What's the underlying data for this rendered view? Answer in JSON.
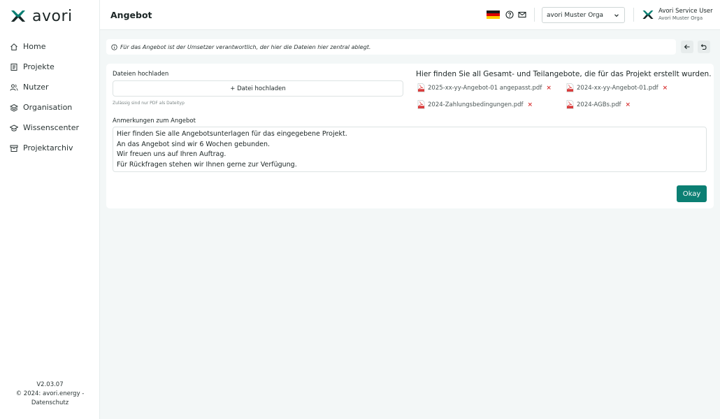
{
  "sidebar": {
    "brand": "avori",
    "items": [
      {
        "label": "Home",
        "icon": "home-icon"
      },
      {
        "label": "Projekte",
        "icon": "document-list-icon"
      },
      {
        "label": "Nutzer",
        "icon": "users-icon"
      },
      {
        "label": "Organisation",
        "icon": "layers-icon"
      },
      {
        "label": "Wissenscenter",
        "icon": "graduation-cap-icon"
      },
      {
        "label": "Projektarchiv",
        "icon": "archive-icon"
      }
    ],
    "version": "V2.03.07",
    "copyright": "© 2024: avori.energy -",
    "privacy": "Datenschutz"
  },
  "header": {
    "title": "Angebot",
    "language_flag": "german-flag",
    "org_select_value": "avori Muster Orga",
    "user_name": "Avori Service User",
    "user_org": "Avori Muster Orga"
  },
  "info": {
    "text": "Für das Angebot ist der Umsetzer verantwortlich, der hier die Dateien hier zentral ablegt."
  },
  "upload": {
    "label": "Dateien hochladen",
    "button": "+ Datei hochladen",
    "hint": "Zulässig sind nur PDF als Dateityp"
  },
  "files": {
    "title": "Hier finden Sie all Gesamt- und Teilangebote, die für das Projekt erstellt wurden.",
    "items": [
      {
        "name": "2025-xx-yy-Angebot-01 angepasst.pdf"
      },
      {
        "name": "2024-xx-yy-Angebot-01.pdf"
      },
      {
        "name": "2024-Zahlungsbedingungen.pdf"
      },
      {
        "name": "2024-AGBs.pdf"
      }
    ],
    "remove_symbol": "×"
  },
  "notes": {
    "label": "Anmerkungen zum Angebot",
    "text": "Hier finden Sie alle Angebotsunterlagen für das eingegebene Projekt.\nAn das Angebot sind wir 6 Wochen gebunden.\nWir freuen uns auf Ihren Auftrag.\nFür Rückfragen stehen wir Ihnen gerne zur Verfügung."
  },
  "actions": {
    "okay": "Okay"
  },
  "colors": {
    "accent": "#0b7f73",
    "remove": "#d93a3a",
    "background": "#f3f7f7"
  }
}
